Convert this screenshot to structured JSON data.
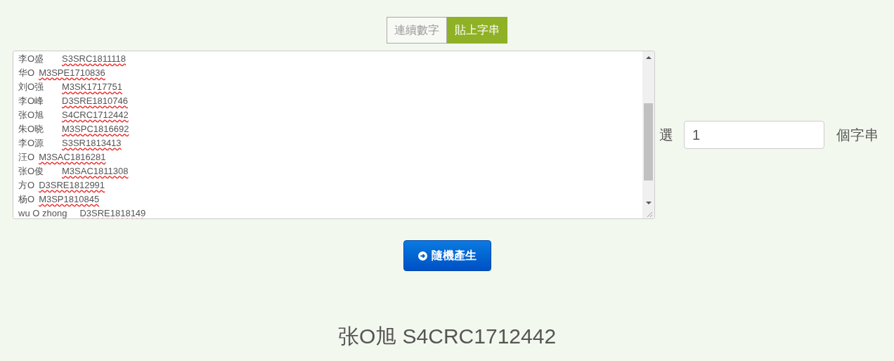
{
  "mode_tabs": [
    {
      "label": "連續數字",
      "selected": false
    },
    {
      "label": "貼上字串",
      "selected": true
    }
  ],
  "lines": [
    {
      "name": "李O盛",
      "code": "S3SRC1811118",
      "kind": "tab"
    },
    {
      "name": "华O",
      "code": "M3SPE1710836",
      "kind": "space"
    },
    {
      "name": "刘O强",
      "code": "M3SK1717751",
      "kind": "tab"
    },
    {
      "name": "李O峰",
      "code": "D3SRE1810746",
      "kind": "tab"
    },
    {
      "name": "张O旭",
      "code": "S4CRC1712442",
      "kind": "tab"
    },
    {
      "name": "朱O晓",
      "code": "M3SPC1816692",
      "kind": "tab"
    },
    {
      "name": "李O源",
      "code": "S3SR1813413",
      "kind": "tab"
    },
    {
      "name": "汪O",
      "code": "M3SAC1816281",
      "kind": "space"
    },
    {
      "name": "张O俊",
      "code": "M3SAC1811308",
      "kind": "tab"
    },
    {
      "name": "方O",
      "code": "D3SRE1812991",
      "kind": "space"
    },
    {
      "name": "杨O",
      "code": "M3SP1810845",
      "kind": "space"
    },
    {
      "name": "wu O zhong",
      "code": "D3SRE1818149",
      "kind": "tab"
    }
  ],
  "pick": {
    "prefix": "選",
    "value": "1",
    "suffix": "個字串"
  },
  "generate_button": "隨機產生",
  "result": "张O旭 S4CRC1712442"
}
